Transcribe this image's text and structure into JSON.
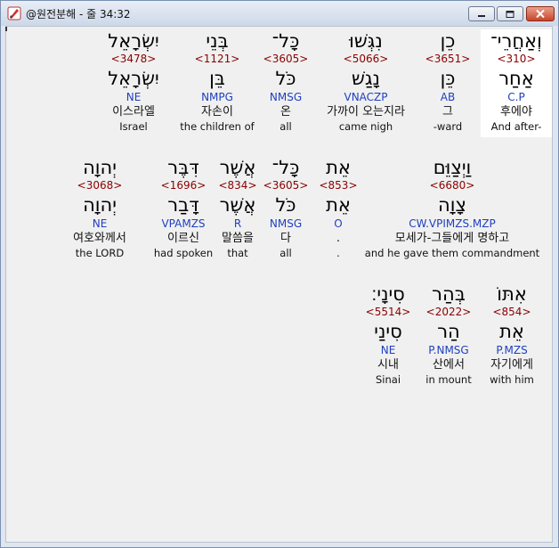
{
  "window": {
    "title": "@원전분해 - 줄 34:32",
    "icon": "app-pen-icon",
    "controls": [
      "minimize-icon",
      "maximize-icon",
      "close-icon"
    ],
    "colors": {
      "strongs": "#8b0000",
      "morph": "#1f3fbf",
      "selected_bg": "#ffffff",
      "pane_bg": "#f0f0f0"
    }
  },
  "rows": [
    {
      "words": [
        {
          "heb": "וְאַחֲרֵי־",
          "num": "<310>",
          "lemma": "אַחַר",
          "morph": "C.P",
          "kor": "후에야",
          "eng": "And after-",
          "selected": true
        },
        {
          "heb": "כֵן",
          "num": "<3651>",
          "lemma": "כֵּן",
          "morph": "AB",
          "kor": "그",
          "eng": "-ward",
          "selected": false
        },
        {
          "heb": "נִגְּשׁוּ",
          "num": "<5066>",
          "lemma": "נָגַשׁ",
          "morph": "VNACZP",
          "kor": "가까이 오는지라",
          "eng": "came nigh",
          "selected": false
        },
        {
          "heb": "כָּל־",
          "num": "<3605>",
          "lemma": "כֹּל",
          "morph": "NMSG",
          "kor": "온",
          "eng": "all",
          "selected": false
        },
        {
          "heb": "בְּנֵי",
          "num": "<1121>",
          "lemma": "בֵּן",
          "morph": "NMPG",
          "kor": "자손이",
          "eng": "the children of",
          "selected": false
        },
        {
          "heb": "יִשְׂרָאֵל",
          "num": "<3478>",
          "lemma": "יִשְׂרָאֵל",
          "morph": "NE",
          "kor": "이스라엘",
          "eng": "Israel",
          "selected": false
        }
      ]
    },
    {
      "words": [
        {
          "heb": "וַיְצַוֵּם",
          "num": "<6680>",
          "lemma": "צָוָה",
          "morph": "CW.VPIMZS.MZP",
          "kor": "모세가-그들에게 명하고",
          "eng": "and he gave them commandment",
          "selected": false
        },
        {
          "heb": "אֵת",
          "num": "<853>",
          "lemma": "אֵת",
          "morph": "O",
          "kor": ".",
          "eng": ".",
          "selected": false
        },
        {
          "heb": "כָּל־",
          "num": "<3605>",
          "lemma": "כֹּל",
          "morph": "NMSG",
          "kor": "다",
          "eng": "all",
          "selected": false
        },
        {
          "heb": "אֲשֶׁר",
          "num": "<834>",
          "lemma": "אֲשֶׁר",
          "morph": "R",
          "kor": "말씀을",
          "eng": "that",
          "selected": false
        },
        {
          "heb": "דִּבֶּר",
          "num": "<1696>",
          "lemma": "דָּבַר",
          "morph": "VPAMZS",
          "kor": "이르신",
          "eng": "had spoken",
          "selected": false
        },
        {
          "heb": "יְהוָה",
          "num": "<3068>",
          "lemma": "יְהוָה",
          "morph": "NE",
          "kor": "여호와께서",
          "eng": "the LORD",
          "selected": false
        }
      ]
    },
    {
      "words": [
        {
          "heb": "אִתּוֹ",
          "num": "<854>",
          "lemma": "אֵת",
          "morph": "P.MZS",
          "kor": "자기에게",
          "eng": "with him",
          "selected": false
        },
        {
          "heb": "בְּהַר",
          "num": "<2022>",
          "lemma": "הַר",
          "morph": "P.NMSG",
          "kor": "산에서",
          "eng": "in mount",
          "selected": false
        },
        {
          "heb": "סִינָי׃",
          "num": "<5514>",
          "lemma": "סִינַי",
          "morph": "NE",
          "kor": "시내",
          "eng": "Sinai",
          "selected": false
        }
      ]
    }
  ]
}
